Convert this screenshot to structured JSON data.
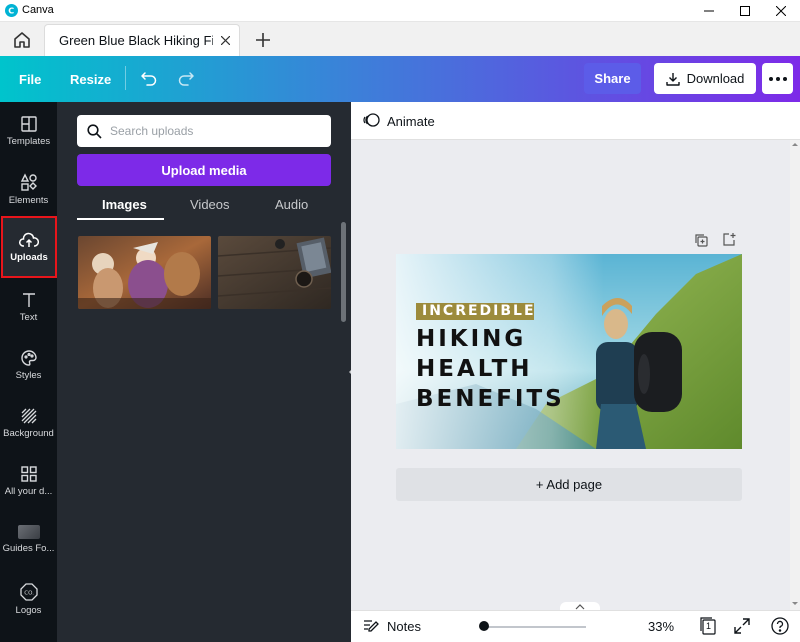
{
  "window": {
    "title": "Canva"
  },
  "tab": {
    "title": "Green Blue Black Hiking Fitness"
  },
  "toolbar": {
    "file": "File",
    "resize": "Resize",
    "share": "Share",
    "download": "Download"
  },
  "rail": {
    "templates": "Templates",
    "elements": "Elements",
    "uploads": "Uploads",
    "text": "Text",
    "styles": "Styles",
    "background": "Background",
    "all_designs": "All your d...",
    "guides": "Guides Fo...",
    "logos": "Logos"
  },
  "panel": {
    "search_placeholder": "Search uploads",
    "upload_button": "Upload media",
    "tabs": {
      "images": "Images",
      "videos": "Videos",
      "audio": "Audio"
    }
  },
  "editor": {
    "animate": "Animate",
    "add_page": "+ Add page"
  },
  "design": {
    "badge": "INCREDIBLE",
    "line1": "HIKING",
    "line2": "HEALTH",
    "line3": "BENEFITS"
  },
  "bottom": {
    "notes": "Notes",
    "zoom": "33%",
    "page_count": "1",
    "zoom_fraction": 0.33
  },
  "colors": {
    "brand_purple": "#7d2ae8",
    "teal": "#00c4cc",
    "highlight_red": "#e8151b",
    "badge_gold": "#9c8b3c"
  }
}
